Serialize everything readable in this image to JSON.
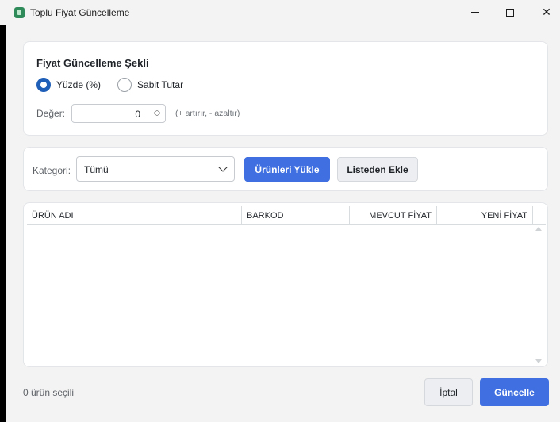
{
  "window": {
    "title": "Toplu Fiyat Güncelleme",
    "app_icon": "app-icon",
    "controls": [
      "minimize-icon",
      "maximize-icon",
      "close-icon"
    ]
  },
  "method": {
    "title": "Fiyat Güncelleme Şekli",
    "options": [
      {
        "label": "Yüzde (%)",
        "selected": true
      },
      {
        "label": "Sabit Tutar",
        "selected": false
      }
    ],
    "value_label": "Değer:",
    "value": "0",
    "hint": "(+ artırır, - azaltır)"
  },
  "filter": {
    "category_label": "Kategori:",
    "category_value": "Tümü",
    "load_button": "Ürünleri Yükle",
    "add_from_list_button": "Listeden Ekle"
  },
  "table": {
    "columns": [
      "ÜRÜN ADI",
      "BARKOD",
      "MEVCUT FİYAT",
      "YENİ FİYAT"
    ],
    "rows": []
  },
  "footer": {
    "status": "0 ürün seçili",
    "cancel_button": "İptal",
    "update_button": "Güncelle"
  },
  "colors": {
    "accent": "#3f6fe0",
    "radio_checked": "#1f5fb8",
    "window_bg": "#f3f3f3"
  }
}
